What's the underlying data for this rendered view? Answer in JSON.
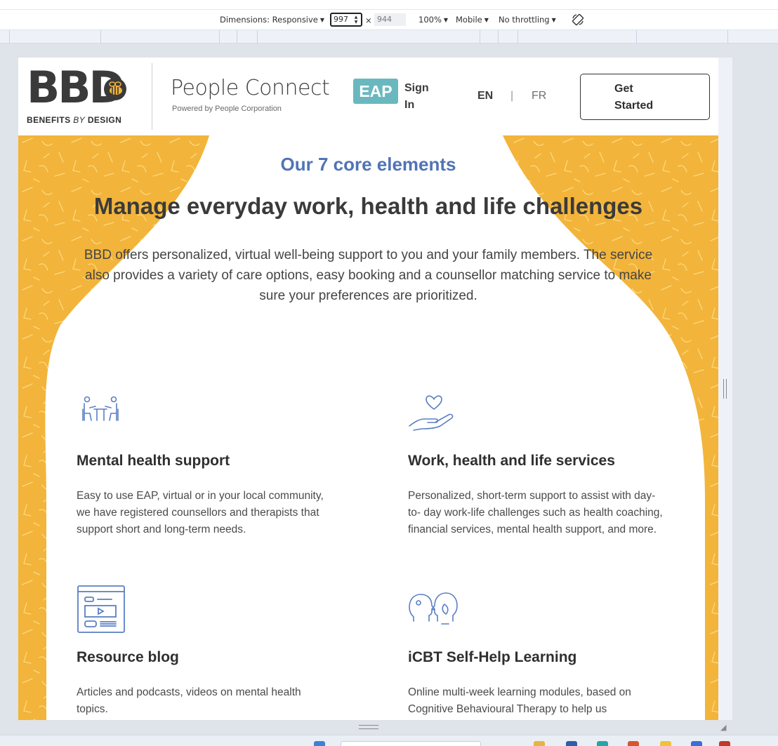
{
  "devtools": {
    "dimensions_label": "Dimensions: Responsive",
    "width_value": "997",
    "times": "×",
    "height_value": "944",
    "zoom": "100%",
    "device": "Mobile",
    "throttling": "No throttling"
  },
  "header": {
    "logo_letters": "BBD",
    "logo_tag_bold1": "BENEFITS",
    "logo_tag_italic": "BY",
    "logo_tag_bold2": "DESIGN",
    "product_name": "People Connect",
    "product_badge": "EAP",
    "powered_by": "Powered by People Corporation",
    "sign_in": "Sign In",
    "lang_en": "EN",
    "lang_separator": "|",
    "lang_fr": "FR",
    "cta": "Get Started"
  },
  "hero": {
    "eyebrow": "Our 7 core elements",
    "heading": "Manage everyday work, health and life challenges",
    "lead": "BBD offers personalized, virtual well-being support to you and your family members. The service also provides a variety of care options, easy booking and a counsellor matching service to make sure your preferences are prioritized."
  },
  "features": [
    {
      "icon": "counselling-session-icon",
      "title": "Mental health support",
      "text": "Easy to use EAP, virtual or in your local community, we have registered counsellors and therapists that support short and long-term needs."
    },
    {
      "icon": "heart-in-hand-icon",
      "title": "Work, health and life services",
      "text": "Personalized, short-term support to assist with day-to- day work-life challenges such as health coaching, financial services, mental health support, and more."
    },
    {
      "icon": "media-browser-icon",
      "title": "Resource blog",
      "text": "Articles and podcasts, videos on mental health topics."
    },
    {
      "icon": "two-heads-icon",
      "title": "iCBT Self-Help Learning",
      "text": "Online multi-week learning modules, based on Cognitive Behavioural Therapy to help us"
    }
  ],
  "colors": {
    "accent_blue": "#5074b5",
    "hero_yellow": "#f2b43a",
    "eap_teal": "#6ab8bf",
    "icon_blue": "#5a7fc4"
  }
}
